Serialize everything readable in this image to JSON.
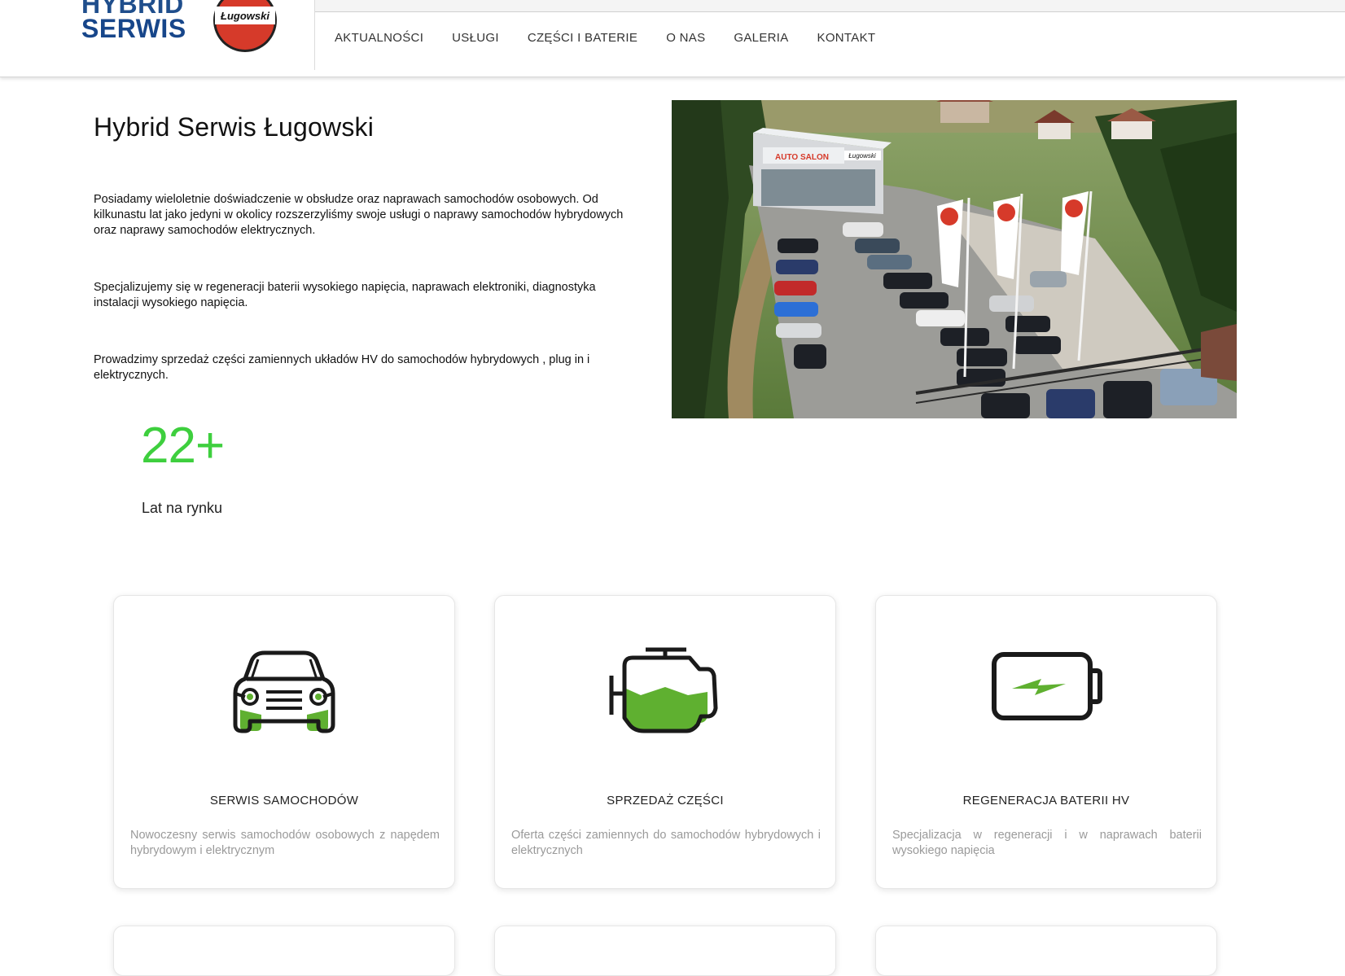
{
  "brand": {
    "logo_line1": "HYBRID",
    "logo_line2": "SERWIS",
    "badge_text": "Ługowski",
    "primary_color": "#1f4e8c",
    "badge_color": "#d63a2a"
  },
  "nav": {
    "items": [
      {
        "label": "AKTUALNOŚCI"
      },
      {
        "label": "USŁUGI"
      },
      {
        "label": "CZĘŚCI I BATERIE"
      },
      {
        "label": "O NAS"
      },
      {
        "label": "GALERIA"
      },
      {
        "label": "KONTAKT"
      }
    ]
  },
  "intro": {
    "title": "Hybrid Serwis Ługowski",
    "paragraphs": [
      "Posiadamy wieloletnie doświadczenie w obsłudze oraz naprawach samochodów osobowych. Od kilkunastu lat jako jedyni w okolicy rozszerzyliśmy swoje usługi o naprawy samochodów hybrydowych oraz naprawy samochodów elektrycznych.",
      "Specjalizujemy się w regeneracji baterii wysokiego napięcia, naprawach elektroniki, diagnostyka instalacji wysokiego napięcia.",
      "Prowadzimy  sprzedaż części zamiennych układów HV do samochodów hybrydowych , plug in i elektrycznych."
    ],
    "photo_sign": "AUTO SALON",
    "photo_sign_brand": "Ługowski"
  },
  "stat": {
    "number": "22+",
    "label": "Lat na rynku",
    "color": "#3ecf3e"
  },
  "services": [
    {
      "icon": "car-icon",
      "title": "SERWIS SAMOCHODÓW",
      "description": "Nowoczesny serwis samochodów osobowych z napędem hybrydowym i elektrycznym"
    },
    {
      "icon": "engine-icon",
      "title": "SPRZEDAŻ CZĘŚCI",
      "description": "Oferta części zamiennych do samochodów hybrydowych i elektrycznych"
    },
    {
      "icon": "battery-icon",
      "title": "REGENERACJA BATERII HV",
      "description": "Specjalizacja w regeneracji i w naprawach baterii wysokiego napięcia"
    }
  ],
  "accent_green": "#5fb030"
}
